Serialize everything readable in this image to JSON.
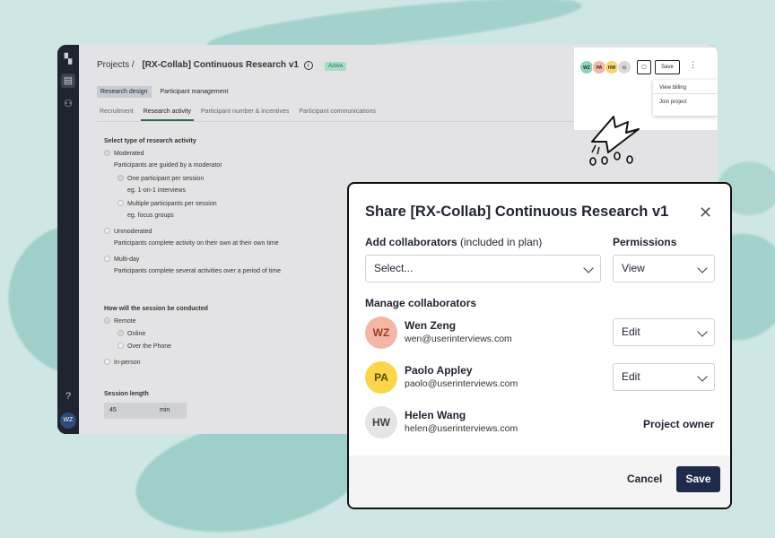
{
  "app": {
    "breadcrumb_root": "Projects /",
    "project_title": "[RX-Collab] Continuous Research v1",
    "status_badge": "Active",
    "subtabs": [
      "Research design",
      "Participant management"
    ],
    "tabs": [
      "Recruitment",
      "Research activity",
      "Participant number & incentives",
      "Participant communications"
    ],
    "sidebar_avatar": "WZ",
    "help_glyph": "?"
  },
  "topbar": {
    "avatars": [
      {
        "initials": "WZ",
        "color": "#8fd3b8"
      },
      {
        "initials": "PA",
        "color": "#f6b6a6"
      },
      {
        "initials": "HW",
        "color": "#f5d76e"
      }
    ],
    "save_label": "Save",
    "menu_items": [
      "View billing",
      "Join project"
    ]
  },
  "form": {
    "q1": "Select type of research activity",
    "opt_moderated": "Moderated",
    "moderated_desc": "Participants are guided by a moderator",
    "opt_one": "One participant per session",
    "one_eg": "eg. 1-on-1 interviews",
    "opt_multi": "Multiple participants per session",
    "multi_eg": "eg. focus groups",
    "opt_unmod": "Unmoderated",
    "unmod_desc": "Participants complete activity on their own at their own time",
    "opt_multiday": "Multi-day",
    "multiday_desc": "Participants complete several activities over a period of time",
    "q2": "How will the session be conducted",
    "opt_remote": "Remote",
    "opt_online": "Online",
    "opt_phone": "Over the Phone",
    "opt_inperson": "In-person",
    "q3": "Session length",
    "session_value": "45",
    "session_unit": "min"
  },
  "modal": {
    "title": "Share [RX-Collab] Continuous Research v1",
    "add_label": "Add collaborators",
    "add_label_note": " (included in plan)",
    "permissions_label": "Permissions",
    "select_placeholder": "Select...",
    "permission_value": "View",
    "manage_label": "Manage collaborators",
    "people": [
      {
        "initials": "WZ",
        "name": "Wen Zeng",
        "email": "wen@userinterviews.com",
        "role": "Edit",
        "color": "#f6b6a6"
      },
      {
        "initials": "PA",
        "name": "Paolo Appley",
        "email": "paolo@userinterviews.com",
        "role": "Edit",
        "color": "#fbd64a"
      },
      {
        "initials": "HW",
        "name": "Helen Wang",
        "email": "helen@userinterviews.com",
        "role": "Project owner",
        "color": "#e5e5e7"
      }
    ],
    "cancel_label": "Cancel",
    "save_label": "Save"
  }
}
